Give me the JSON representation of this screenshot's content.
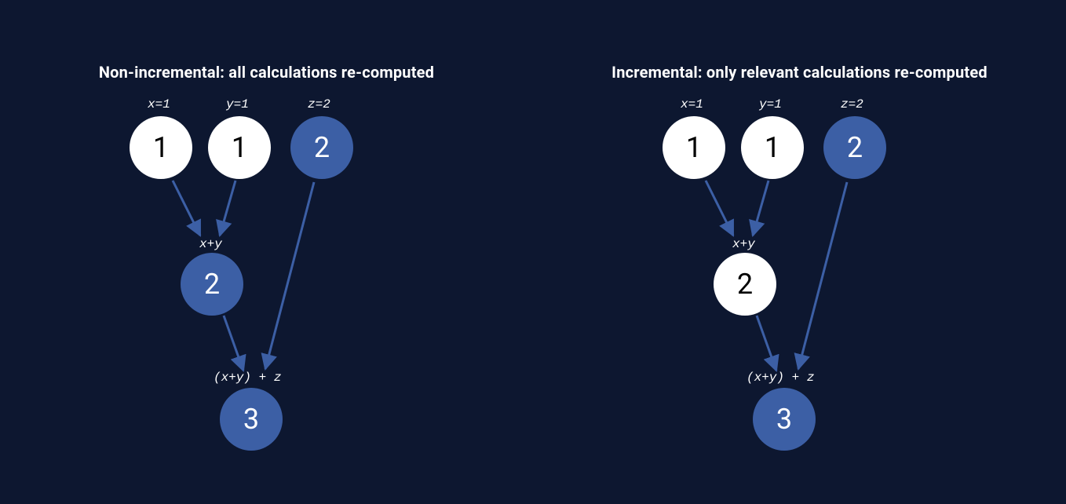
{
  "diagrams": {
    "left": {
      "title": "Non-incremental: all calculations re-computed",
      "nodes": {
        "x": {
          "label": "x=1",
          "value": "1",
          "color": "white"
        },
        "y": {
          "label": "y=1",
          "value": "1",
          "color": "white"
        },
        "z": {
          "label": "z=2",
          "value": "2",
          "color": "blue"
        },
        "xy": {
          "label": "x+y",
          "value": "2",
          "color": "blue"
        },
        "sum": {
          "label": "(x+y) + z",
          "value": "3",
          "color": "blue"
        }
      }
    },
    "right": {
      "title": "Incremental: only relevant calculations re-computed",
      "nodes": {
        "x": {
          "label": "x=1",
          "value": "1",
          "color": "white"
        },
        "y": {
          "label": "y=1",
          "value": "1",
          "color": "white"
        },
        "z": {
          "label": "z=2",
          "value": "2",
          "color": "blue"
        },
        "xy": {
          "label": "x+y",
          "value": "2",
          "color": "white"
        },
        "sum": {
          "label": "(x+y) + z",
          "value": "3",
          "color": "blue"
        }
      }
    }
  },
  "colors": {
    "background": "#0d1730",
    "node_blue": "#3c5fa5",
    "node_white": "#ffffff",
    "arrow": "#3c5fa5"
  },
  "chart_data": {
    "type": "diagram",
    "description": "Computation graph comparison",
    "graphs": [
      {
        "name": "Non-incremental",
        "title": "Non-incremental: all calculations re-computed",
        "inputs": [
          {
            "var": "x",
            "value": 1,
            "recomputed": false
          },
          {
            "var": "y",
            "value": 1,
            "recomputed": false
          },
          {
            "var": "z",
            "value": 2,
            "recomputed": true
          }
        ],
        "computations": [
          {
            "expr": "x+y",
            "value": 2,
            "recomputed": true,
            "depends_on": [
              "x",
              "y"
            ]
          },
          {
            "expr": "(x+y) + z",
            "value": 3,
            "recomputed": true,
            "depends_on": [
              "x+y",
              "z"
            ]
          }
        ]
      },
      {
        "name": "Incremental",
        "title": "Incremental: only relevant calculations re-computed",
        "inputs": [
          {
            "var": "x",
            "value": 1,
            "recomputed": false
          },
          {
            "var": "y",
            "value": 1,
            "recomputed": false
          },
          {
            "var": "z",
            "value": 2,
            "recomputed": true
          }
        ],
        "computations": [
          {
            "expr": "x+y",
            "value": 2,
            "recomputed": false,
            "depends_on": [
              "x",
              "y"
            ]
          },
          {
            "expr": "(x+y) + z",
            "value": 3,
            "recomputed": true,
            "depends_on": [
              "x+y",
              "z"
            ]
          }
        ]
      }
    ]
  }
}
